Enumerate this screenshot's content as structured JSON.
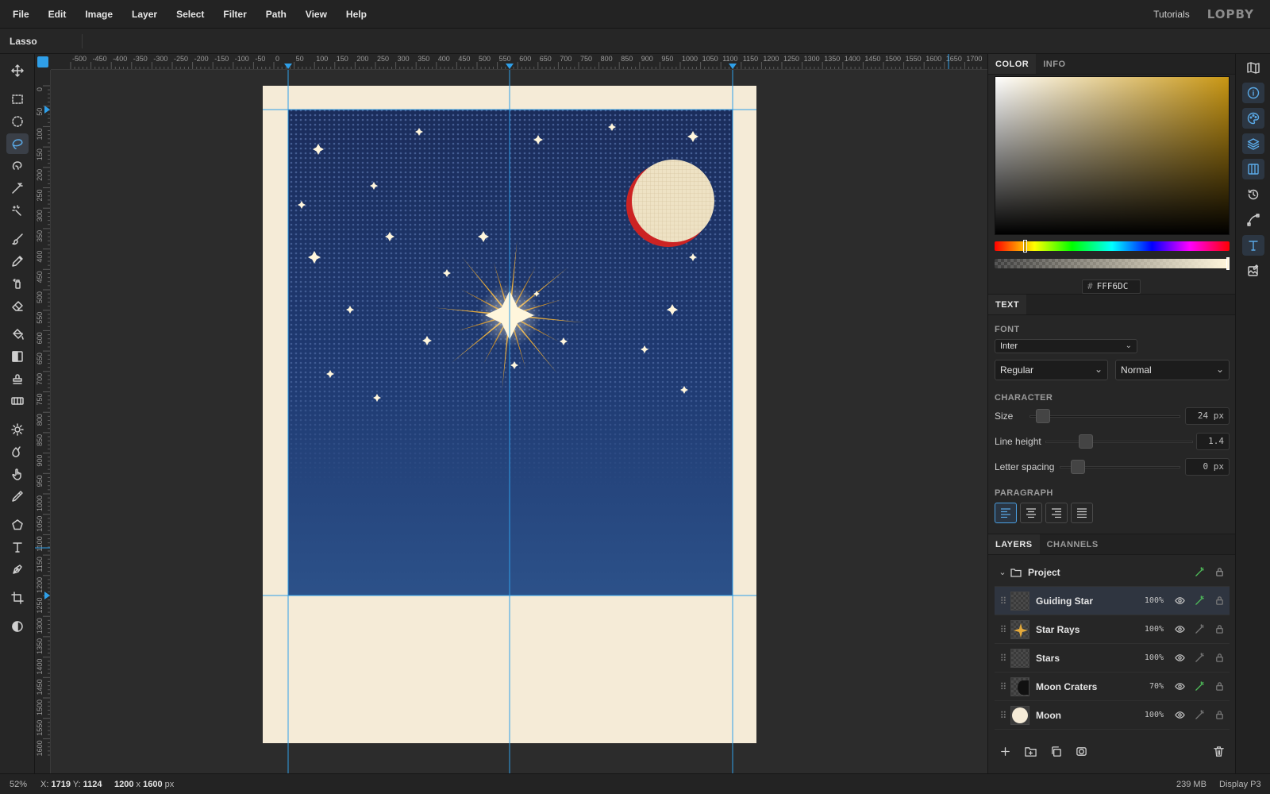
{
  "menu": [
    "File",
    "Edit",
    "Image",
    "Layer",
    "Select",
    "Filter",
    "Path",
    "View",
    "Help"
  ],
  "header": {
    "tutorials": "Tutorials",
    "logo": "LOPBY"
  },
  "options": {
    "tool_name": "Lasso"
  },
  "rulers": {
    "h_labels": [
      "-500",
      "-450",
      "-400",
      "-350",
      "-300",
      "-250",
      "-200",
      "-150",
      "-100",
      "-50",
      "0",
      "50",
      "100",
      "150",
      "200",
      "250",
      "300",
      "350",
      "400",
      "450",
      "500",
      "550",
      "600",
      "650",
      "700",
      "750",
      "800",
      "850",
      "900",
      "950",
      "1000",
      "1050",
      "1100",
      "1150",
      "1200",
      "1250",
      "1300",
      "1350",
      "1400",
      "1450",
      "1500",
      "1550",
      "1600",
      "1650",
      "1700"
    ],
    "v_labels": [
      "0",
      "50",
      "100",
      "150",
      "200",
      "250",
      "300",
      "350",
      "400",
      "450",
      "500",
      "550",
      "600",
      "650",
      "700",
      "750",
      "800",
      "850",
      "900",
      "950",
      "1000",
      "1050",
      "1100",
      "1150",
      "1200",
      "1250",
      "1300",
      "1350",
      "1400",
      "1450",
      "1500",
      "1550",
      "1600"
    ]
  },
  "tools": [
    "move-tool",
    "rect-select-tool",
    "ellipse-select-tool",
    "lasso-tool",
    "quick-select-tool",
    "magic-wand-tool",
    "spot-heal-tool",
    "brush-tool",
    "pencil-tool",
    "spray-tool",
    "eraser-tool",
    "bucket-tool",
    "gradient-tool",
    "stamp-tool",
    "pattern-tool",
    "dodge-tool",
    "blur-tool",
    "smudge-tool",
    "eyedropper-tool",
    "shape-tool",
    "text-tool",
    "pen-tool",
    "crop-tool",
    "mask-mode-tool"
  ],
  "color_panel": {
    "tabs": [
      "COLOR",
      "INFO"
    ],
    "hex_label": "#",
    "hex": "FFF6DC",
    "hue_color": "#c89613"
  },
  "text_panel": {
    "tab": "TEXT",
    "font_label": "FONT",
    "font": "Inter",
    "weight": "Regular",
    "style": "Normal",
    "character_label": "CHARACTER",
    "size_label": "Size",
    "size_value": "24 px",
    "line_height_label": "Line height",
    "line_height_value": "1.4",
    "letter_spacing_label": "Letter spacing",
    "letter_spacing_value": "0 px",
    "paragraph_label": "PARAGRAPH",
    "alignments": [
      "align-left",
      "align-center",
      "align-right",
      "align-justify"
    ],
    "active_alignment": "align-left"
  },
  "layers_panel": {
    "tabs": [
      "LAYERS",
      "CHANNELS"
    ],
    "group": "Project",
    "layers": [
      {
        "name": "Guiding Star",
        "opacity": "100%",
        "fx": true,
        "selected": true
      },
      {
        "name": "Star Rays",
        "opacity": "100%",
        "fx": false,
        "selected": false
      },
      {
        "name": "Stars",
        "opacity": "100%",
        "fx": false,
        "selected": false
      },
      {
        "name": "Moon Craters",
        "opacity": "70%",
        "fx": true,
        "selected": false
      },
      {
        "name": "Moon",
        "opacity": "100%",
        "fx": false,
        "selected": false
      }
    ]
  },
  "status": {
    "zoom": "52%",
    "x_label": "X:",
    "x": "1719",
    "y_label": "Y:",
    "y": "1124",
    "width": "1200",
    "times": "x",
    "height": "1600",
    "unit": "px",
    "memory": "239 MB",
    "color_profile": "Display P3"
  },
  "colors": {
    "accent": "#2f9fe8",
    "paper": "#f5ebd7",
    "sky_top": "#1b2d5c",
    "sky_bottom": "#2c5189",
    "star_gold": "#e4a93a",
    "moon": "#eee2c4",
    "moon_shadow": "#cc2323"
  }
}
